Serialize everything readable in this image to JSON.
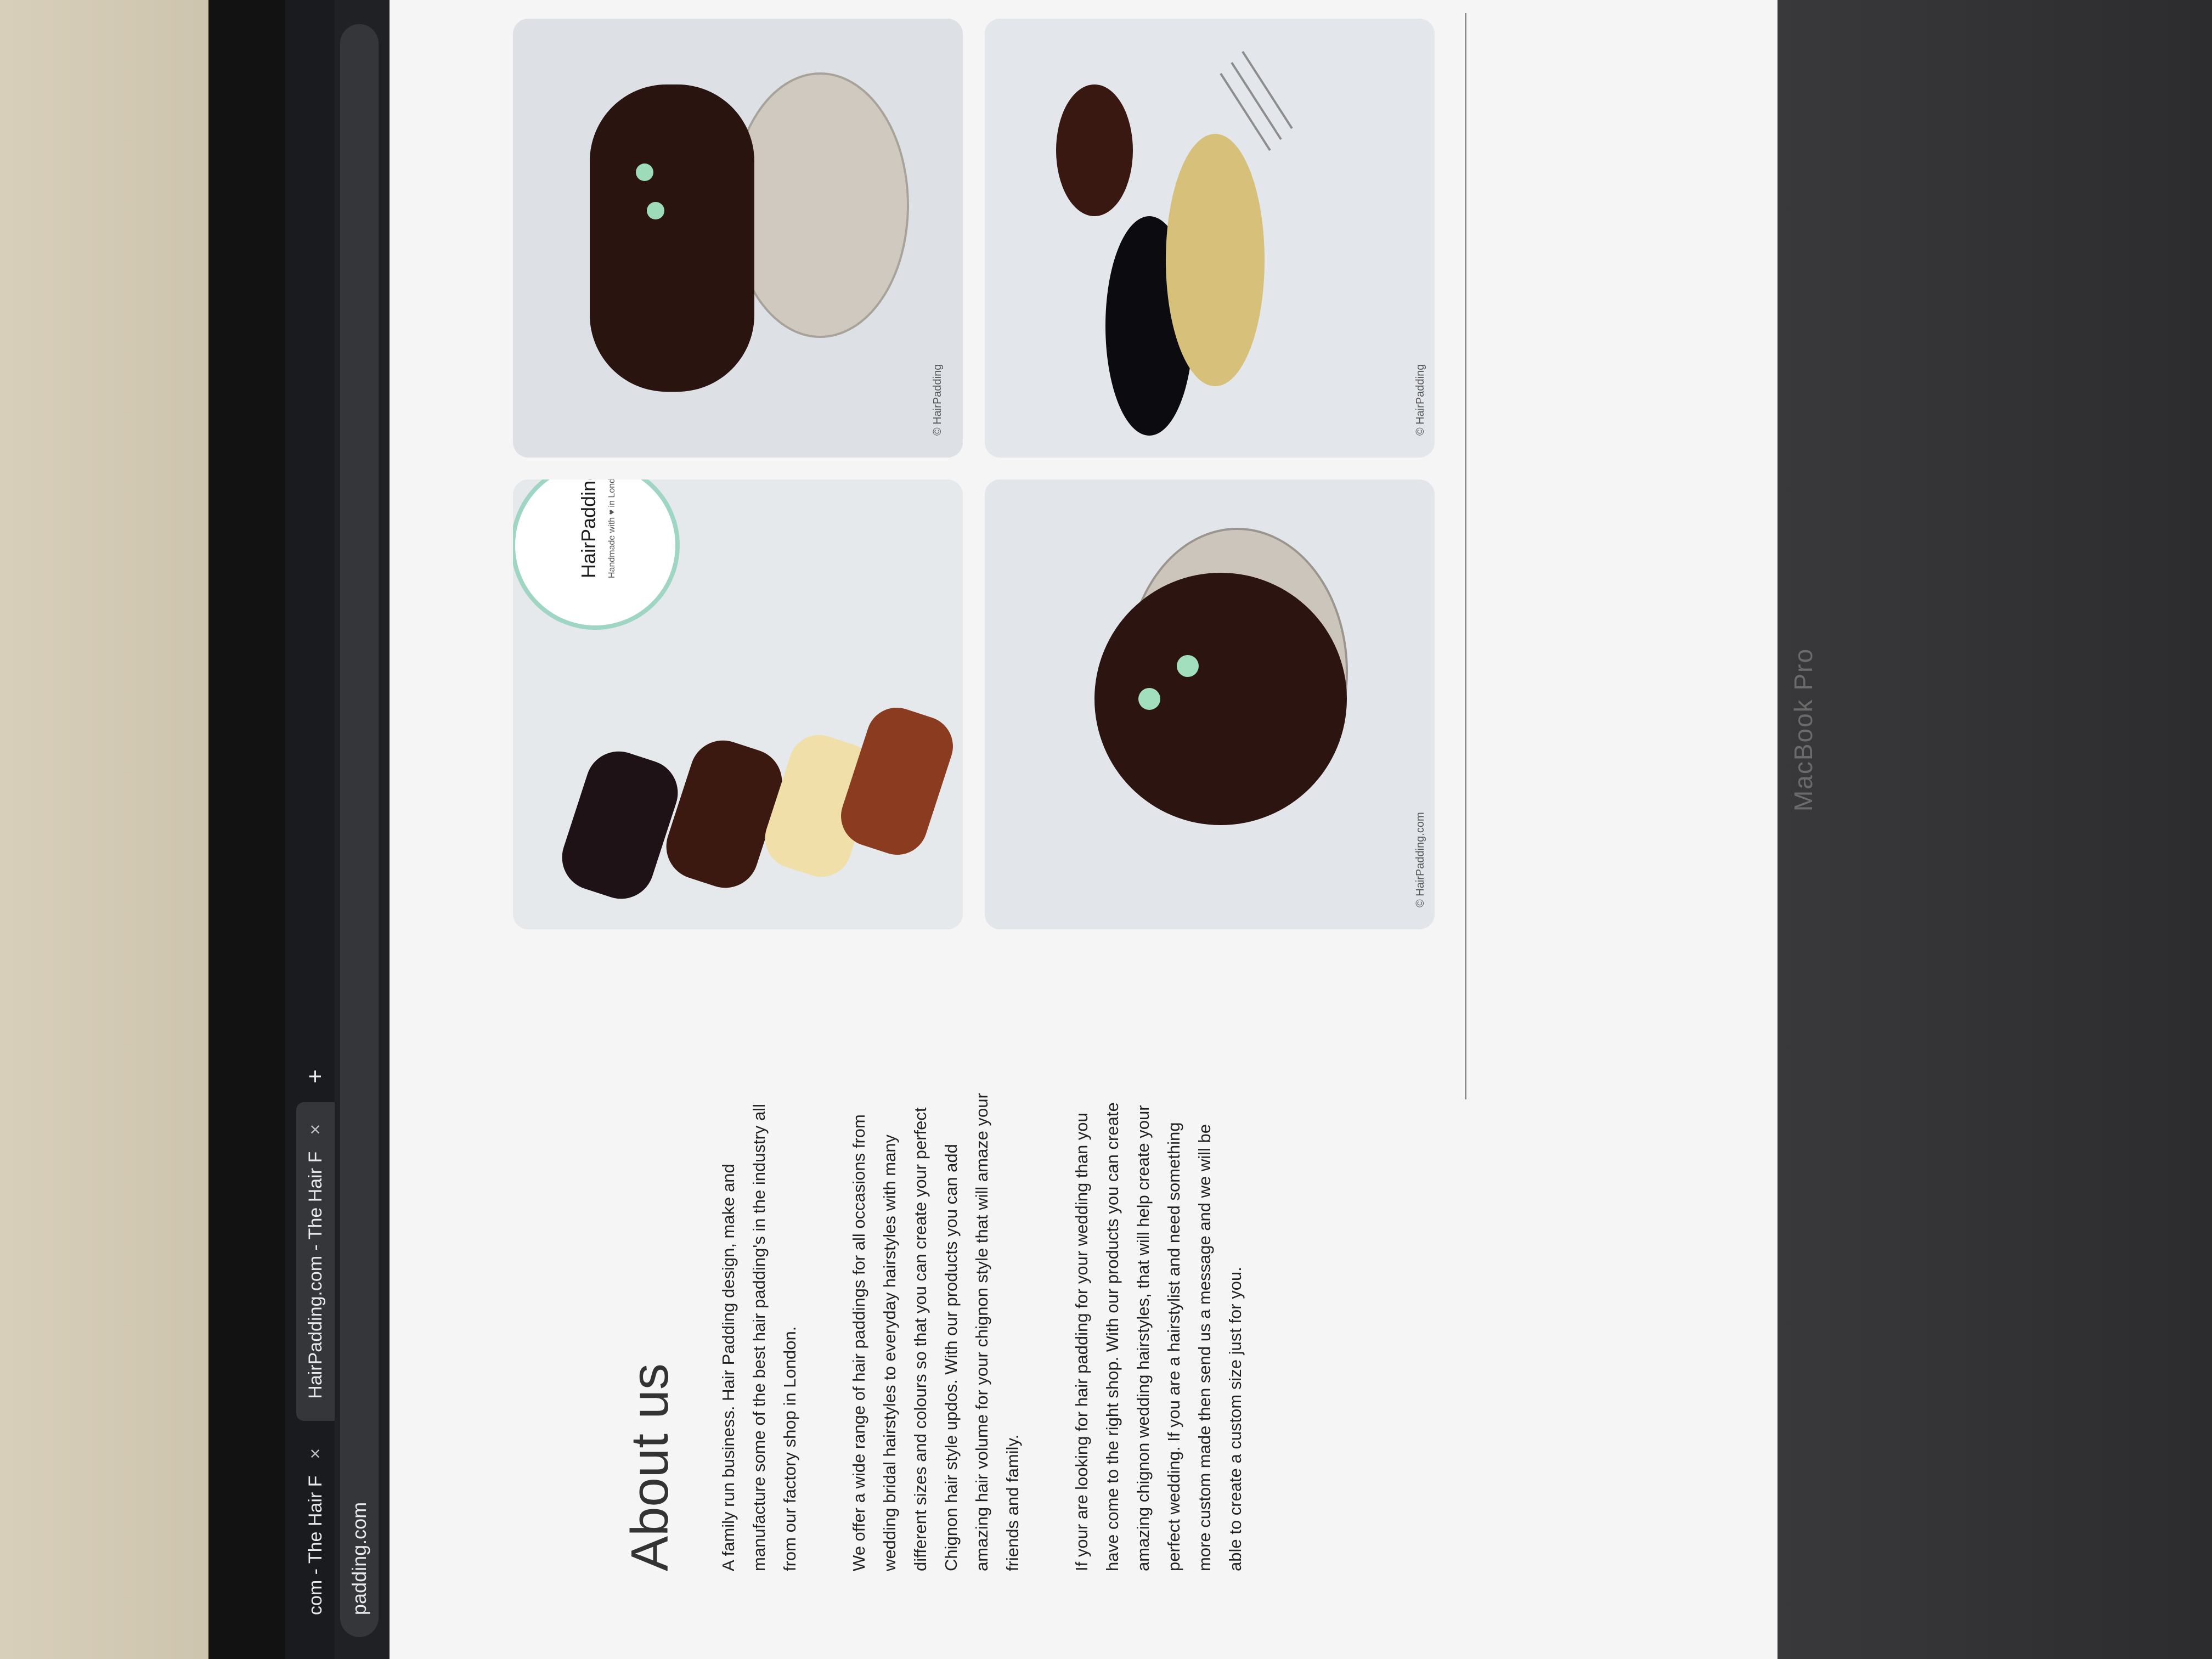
{
  "browser": {
    "tabs": [
      {
        "label": "com - The Hair F"
      },
      {
        "label": "HairPadding.com - The Hair F"
      }
    ],
    "new_tab_symbol": "+",
    "close_symbol": "×",
    "address": "padding.com"
  },
  "about": {
    "heading": "About us",
    "paragraphs": [
      "A family run business. Hair Padding design, make and manufacture some of the best hair padding's in the industry all from our factory shop in London.",
      "We offer a wide range of hair paddings for all occasions from wedding bridal hairstyles to everyday hairstyles with many different sizes and colours so that you can create your perfect Chignon hair style updos. With our products you can add amazing hair volume for your chignon style that will amaze your friends and family.",
      "If your are looking for hair padding for your wedding than you have come to the right shop. With our products you can create amazing chignon wedding hairstyles, that will help create your perfect wedding. If you are a hairstylist and need something more custom made then send us a message and we will be able to create a custom size just for you."
    ]
  },
  "gallery": {
    "logo_name": "HairPadding",
    "logo_tagline": "Handmade with ♥ in London",
    "credit_1": "© HairPadding",
    "credit_2": "© HairPadding.com",
    "credit_3": "© HairPadding"
  },
  "device": {
    "label": "MacBook Pro"
  },
  "colors": {
    "chrome": "#202124",
    "page_bg": "#f5f5f6",
    "text": "#222222"
  }
}
